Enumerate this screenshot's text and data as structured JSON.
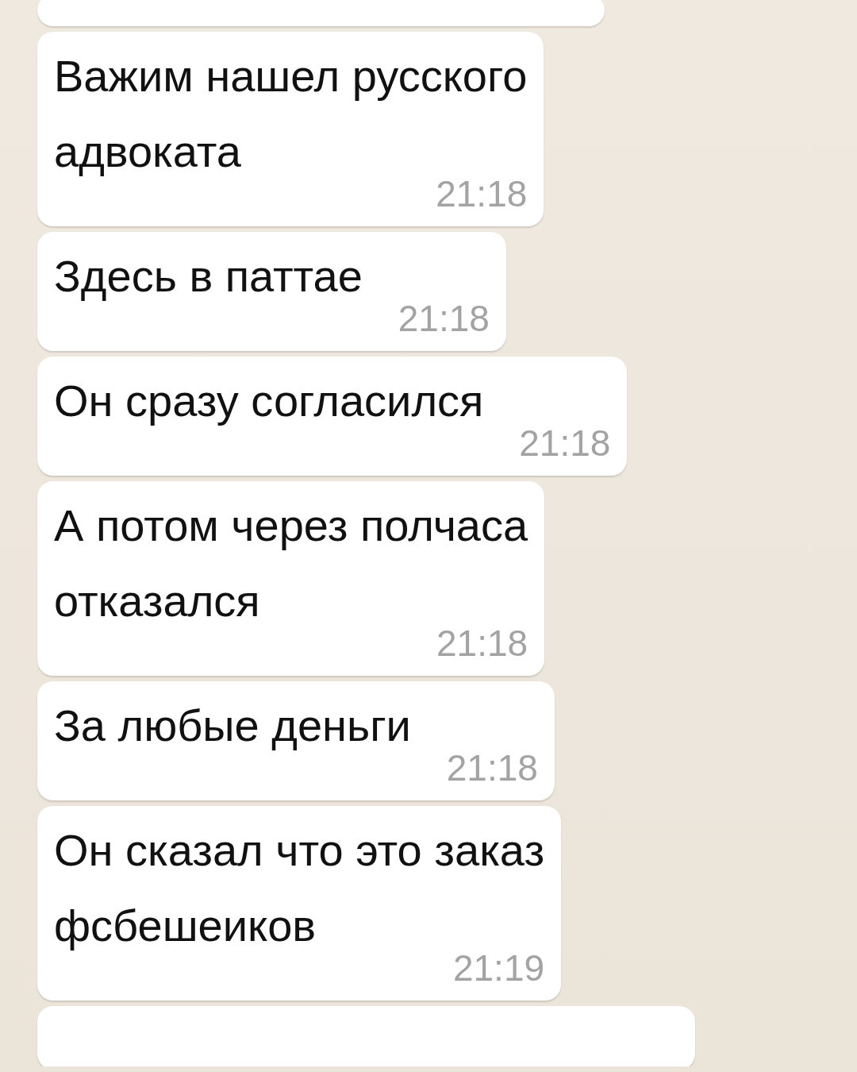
{
  "messages": [
    {
      "text": "Важим нашел русского\nадвоката",
      "time": "21:18"
    },
    {
      "text": "Здесь в паттае",
      "time": "21:18"
    },
    {
      "text": "Он сразу согласился",
      "time": "21:18"
    },
    {
      "text": "А потом через полчаса\nотказался",
      "time": "21:18"
    },
    {
      "text": "За любые деньги",
      "time": "21:18"
    },
    {
      "text": "Он сказал что это заказ\nфсбешеиков",
      "time": "21:19"
    }
  ]
}
